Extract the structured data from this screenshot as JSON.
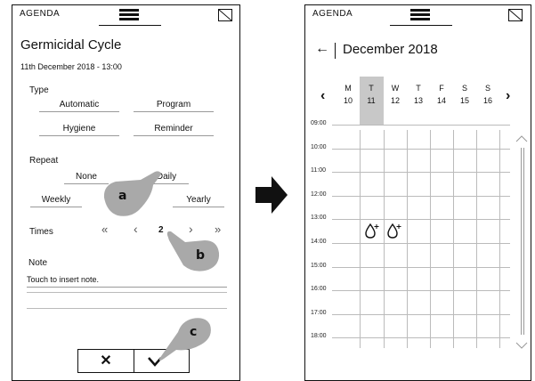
{
  "left": {
    "header_label": "AGENDA",
    "title": "Germicidal Cycle",
    "datetime": "11th December 2018 - 13:00",
    "type_label": "Type",
    "type_options": [
      "Automatic",
      "Program",
      "Hygiene",
      "Reminder"
    ],
    "repeat_label": "Repeat",
    "repeat_options": [
      "None",
      "Daily",
      "Weekly",
      "Yearly"
    ],
    "times_label": "Times",
    "times_value": "2",
    "times_first": "«",
    "times_prev": "‹",
    "times_next": "›",
    "times_last": "»",
    "note_label": "Note",
    "note_placeholder": "Touch to insert note.",
    "cancel_glyph": "✕",
    "confirm_glyph": "✓"
  },
  "right": {
    "header_label": "AGENDA",
    "back_glyph": "←",
    "month": "December 2018",
    "prev_glyph": "‹",
    "next_glyph": "›",
    "days": [
      {
        "letter": "M",
        "num": "10"
      },
      {
        "letter": "T",
        "num": "11"
      },
      {
        "letter": "W",
        "num": "12"
      },
      {
        "letter": "T",
        "num": "13"
      },
      {
        "letter": "F",
        "num": "14"
      },
      {
        "letter": "S",
        "num": "15"
      },
      {
        "letter": "S",
        "num": "16"
      }
    ],
    "times": [
      "09:00",
      "10:00",
      "11:00",
      "12:00",
      "13:00",
      "14:00",
      "15:00",
      "16:00",
      "17:00",
      "18:00"
    ]
  },
  "callouts": {
    "a": "a",
    "b": "b",
    "c": "c"
  },
  "colors": {
    "selected_day": "#c8c8c8",
    "line": "#111111",
    "hand": "#a9a9a9"
  }
}
